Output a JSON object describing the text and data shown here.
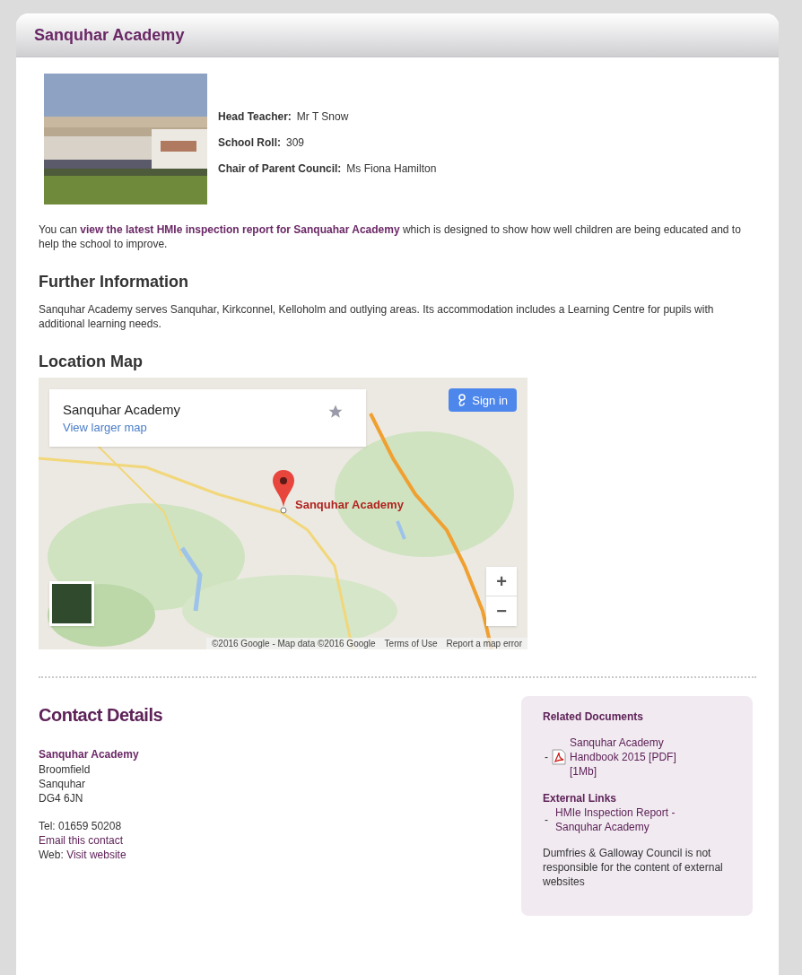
{
  "panel": {
    "title": "Sanquhar Academy"
  },
  "facts": [
    {
      "label": "Head Teacher:",
      "value": "Mr T Snow"
    },
    {
      "label": "School Roll:",
      "value": "309"
    },
    {
      "label": "Chair of Parent Council:",
      "value": "Ms Fiona Hamilton"
    }
  ],
  "intro": {
    "before": "You can ",
    "link": "view the latest HMIe inspection report for Sanquahar Academy",
    "after": " which is designed to show how well children are being educated and to help the school to improve."
  },
  "further": {
    "heading": "Further Information",
    "text": "Sanquhar Academy serves Sanquhar, Kirkconnel, Kelloholm and outlying areas. Its accommodation includes a Learning Centre for pupils with additional learning needs."
  },
  "map": {
    "heading": "Location Map",
    "card_title": "Sanquhar Academy",
    "card_link": "View larger map",
    "sign_in": "Sign in",
    "marker_label": "Sanquhar Academy",
    "zoom_in": "+",
    "zoom_out": "−",
    "attribution": "©2016 Google - Map data ©2016 Google",
    "terms": "Terms of Use",
    "report": "Report a map error"
  },
  "contact": {
    "heading": "Contact Details",
    "name": "Sanquhar Academy",
    "address": [
      "Broomfield",
      "Sanquhar",
      "DG4 6JN"
    ],
    "tel": "Tel: 01659 50208",
    "email": "Email this contact",
    "web_label": "Web: ",
    "web_link": "Visit website"
  },
  "aside": {
    "docs_heading": "Related Documents",
    "docs": [
      {
        "bullet": "-",
        "label": "Sanquhar Academy Handbook 2015 [PDF] [1Mb]"
      }
    ],
    "links_heading": "External Links",
    "links": [
      {
        "bullet": "-",
        "label": "HMIe Inspection Report - Sanquhar Academy"
      }
    ],
    "disclaimer": "Dumfries & Galloway Council is not responsible for the content of external websites"
  }
}
